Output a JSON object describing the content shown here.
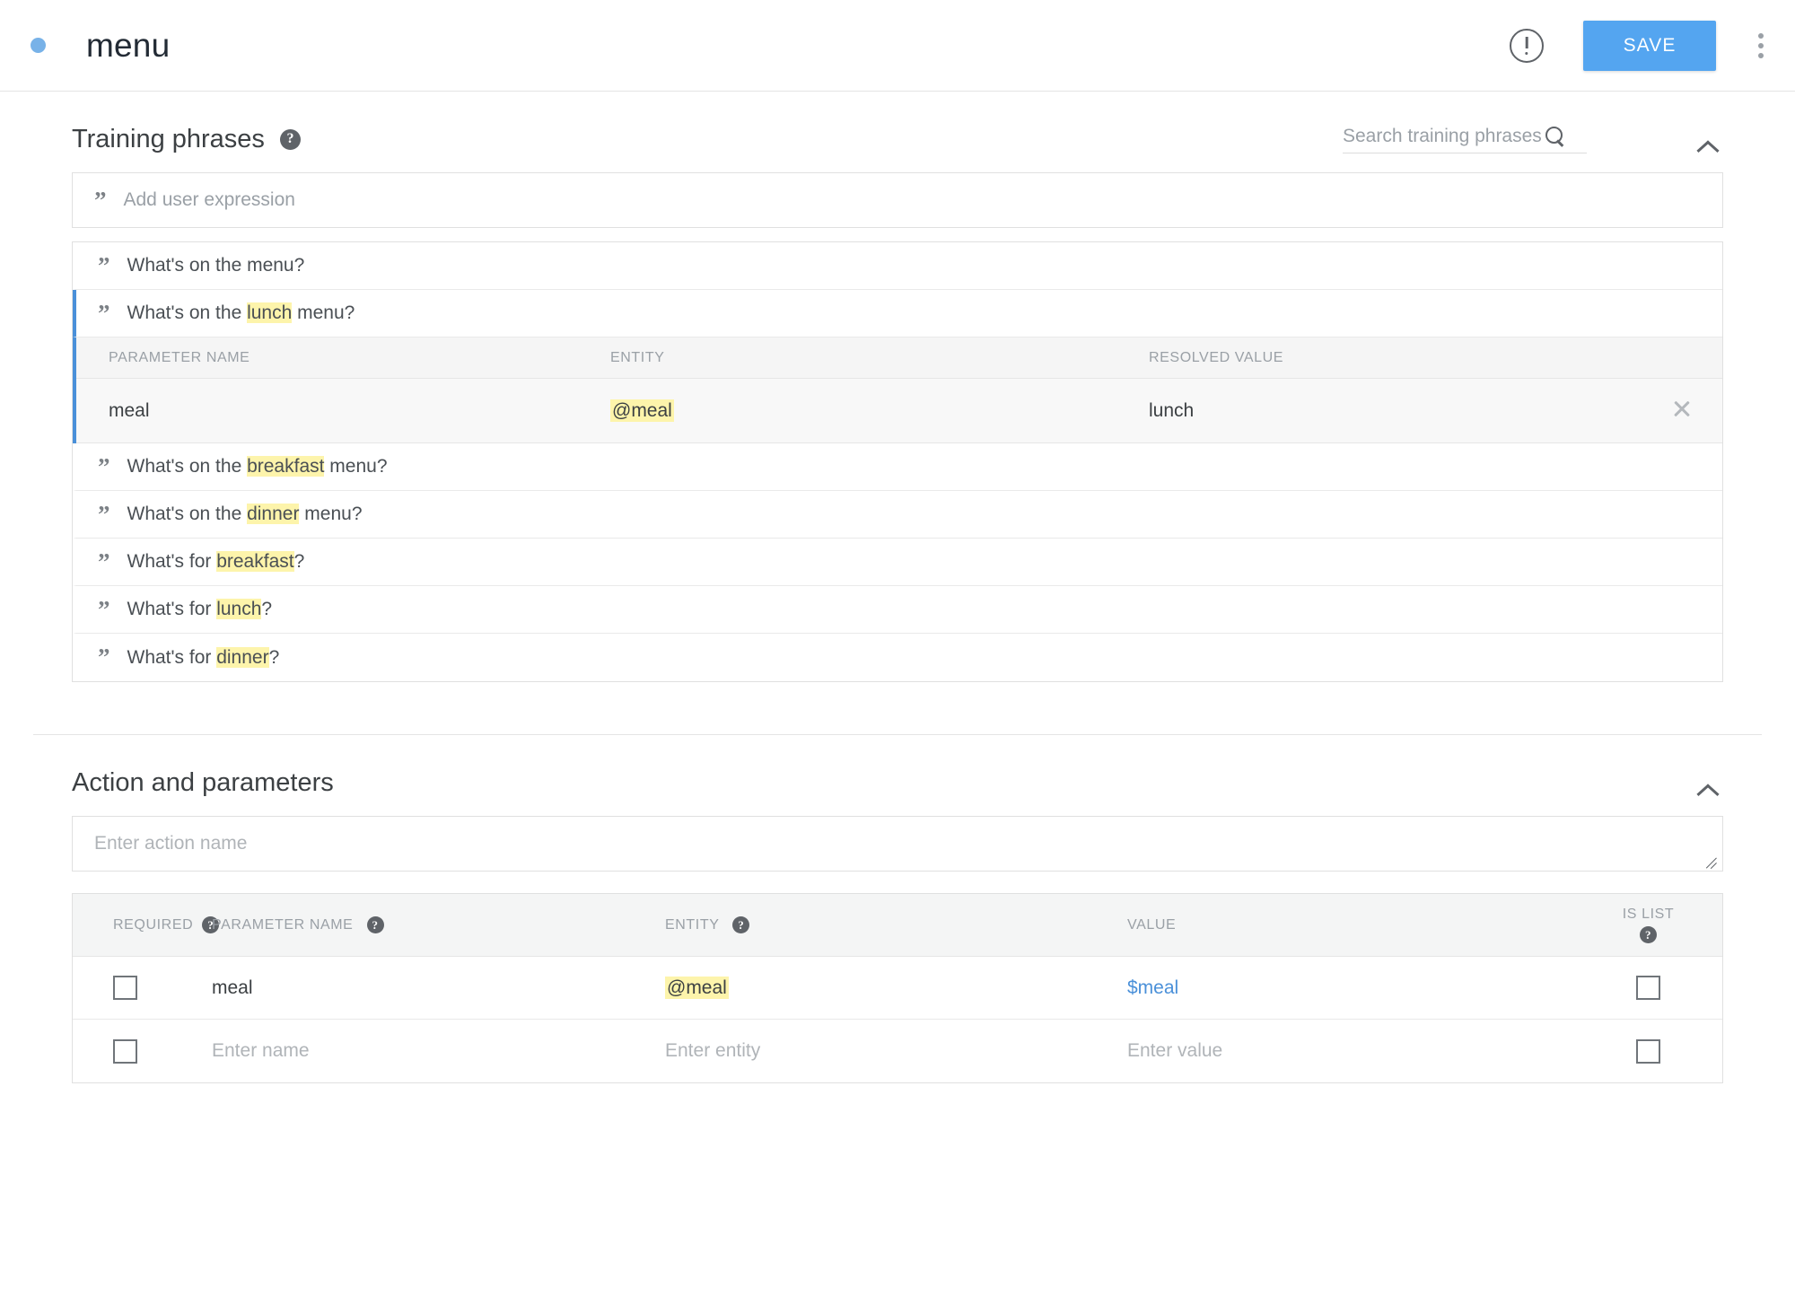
{
  "topbar": {
    "intent_name": "menu",
    "status_dot_color": "#78b2e8",
    "error_icon": "error-outline-icon",
    "save_label": "SAVE",
    "save_color": "#54a5f0",
    "overflow_icon": "more-vert-icon"
  },
  "training_phrases": {
    "title": "Training phrases",
    "help_glyph": "?",
    "search": {
      "placeholder": "Search training phrases",
      "value": "",
      "icon": "search-icon"
    },
    "collapse_icon": "chevron-up-icon",
    "add_row": {
      "quote_glyph": "”",
      "placeholder": "Add user expression"
    },
    "highlight_color": "#fdf4ab",
    "selected_accent": "#4a90d9",
    "rows": [
      {
        "parts": [
          {
            "t": "What's on the menu?",
            "hl": false
          }
        ],
        "selected": false
      },
      {
        "parts": [
          {
            "t": "What's on the ",
            "hl": false
          },
          {
            "t": "lunch",
            "hl": true
          },
          {
            "t": " menu?",
            "hl": false
          }
        ],
        "selected": true
      },
      {
        "parts": [
          {
            "t": "What's on the ",
            "hl": false
          },
          {
            "t": "breakfast",
            "hl": true
          },
          {
            "t": " menu?",
            "hl": false
          }
        ],
        "selected": false
      },
      {
        "parts": [
          {
            "t": "What's on the ",
            "hl": false
          },
          {
            "t": "dinner",
            "hl": true
          },
          {
            "t": " menu?",
            "hl": false
          }
        ],
        "selected": false
      },
      {
        "parts": [
          {
            "t": "What's for ",
            "hl": false
          },
          {
            "t": "breakfast",
            "hl": true
          },
          {
            "t": "?",
            "hl": false
          }
        ],
        "selected": false
      },
      {
        "parts": [
          {
            "t": "What's for ",
            "hl": false
          },
          {
            "t": "lunch",
            "hl": true
          },
          {
            "t": "?",
            "hl": false
          }
        ],
        "selected": false
      },
      {
        "parts": [
          {
            "t": "What's for ",
            "hl": false
          },
          {
            "t": "dinner",
            "hl": true
          },
          {
            "t": "?",
            "hl": false
          }
        ],
        "selected": false
      }
    ],
    "param_table": {
      "headers": [
        "PARAMETER NAME",
        "ENTITY",
        "RESOLVED VALUE"
      ],
      "row": {
        "parameter_name": "meal",
        "entity": "@meal",
        "resolved_value": "lunch",
        "delete_icon": "close-icon"
      }
    }
  },
  "action_and_parameters": {
    "title": "Action and parameters",
    "collapse_icon": "chevron-up-icon",
    "action_input": {
      "placeholder": "Enter action name",
      "value": ""
    },
    "headers": {
      "required": "REQUIRED",
      "parameter_name": "PARAMETER NAME",
      "entity": "ENTITY",
      "value": "VALUE",
      "is_list": "IS LIST"
    },
    "rows": [
      {
        "required_checked": false,
        "parameter_name": "meal",
        "parameter_name_placeholder": "",
        "entity": "@meal",
        "entity_placeholder": "",
        "value": "$meal",
        "value_placeholder": "",
        "is_list_checked": false,
        "is_empty_row": false
      },
      {
        "required_checked": false,
        "parameter_name": "",
        "parameter_name_placeholder": "Enter name",
        "entity": "",
        "entity_placeholder": "Enter entity",
        "value": "",
        "value_placeholder": "Enter value",
        "is_list_checked": false,
        "is_empty_row": true
      }
    ]
  }
}
